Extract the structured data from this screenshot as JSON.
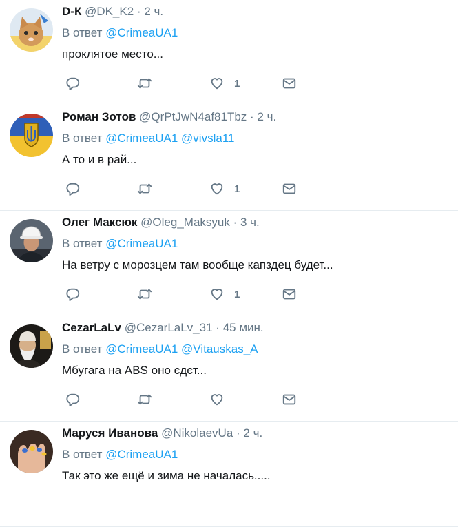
{
  "reply_prefix": "В ответ",
  "tweets": [
    {
      "name": "D-К",
      "handle": "@DK_K2",
      "time": "2 ч.",
      "reply_to": [
        "@CrimeaUA1"
      ],
      "text": "проклятое место...",
      "likes": "1"
    },
    {
      "name": "Роман Зотов",
      "handle": "@QrPtJwN4af81Tbz",
      "time": "2 ч.",
      "reply_to": [
        "@CrimeaUA1",
        "@vivsla11"
      ],
      "text": "А то и в рай...",
      "likes": "1"
    },
    {
      "name": "Олег Максюк",
      "handle": "@Oleg_Maksyuk",
      "time": "3 ч.",
      "reply_to": [
        "@CrimeaUA1"
      ],
      "text": "На ветру с морозцем там вообще капздец будет...",
      "likes": "1"
    },
    {
      "name": "CezarLaLv",
      "handle": "@CezarLaLv_31",
      "time": "45 мин.",
      "reply_to": [
        "@CrimeaUA1",
        "@Vitauskas_A"
      ],
      "text": "Мбугага на ABS  оно єдєт...",
      "likes": ""
    },
    {
      "name": "Маруся Иванова",
      "handle": "@NikolaevUa",
      "time": "2 ч.",
      "reply_to": [
        "@CrimeaUA1"
      ],
      "text": "Так это же ещё и зима не началась.....",
      "likes": ""
    }
  ],
  "colors": {
    "accent": "#1da1f2",
    "secondary_text": "#657786",
    "primary_text": "#14171a",
    "divider": "#e6ecf0"
  },
  "icons": [
    "reply-icon",
    "retweet-icon",
    "like-icon",
    "direct-message-icon"
  ]
}
